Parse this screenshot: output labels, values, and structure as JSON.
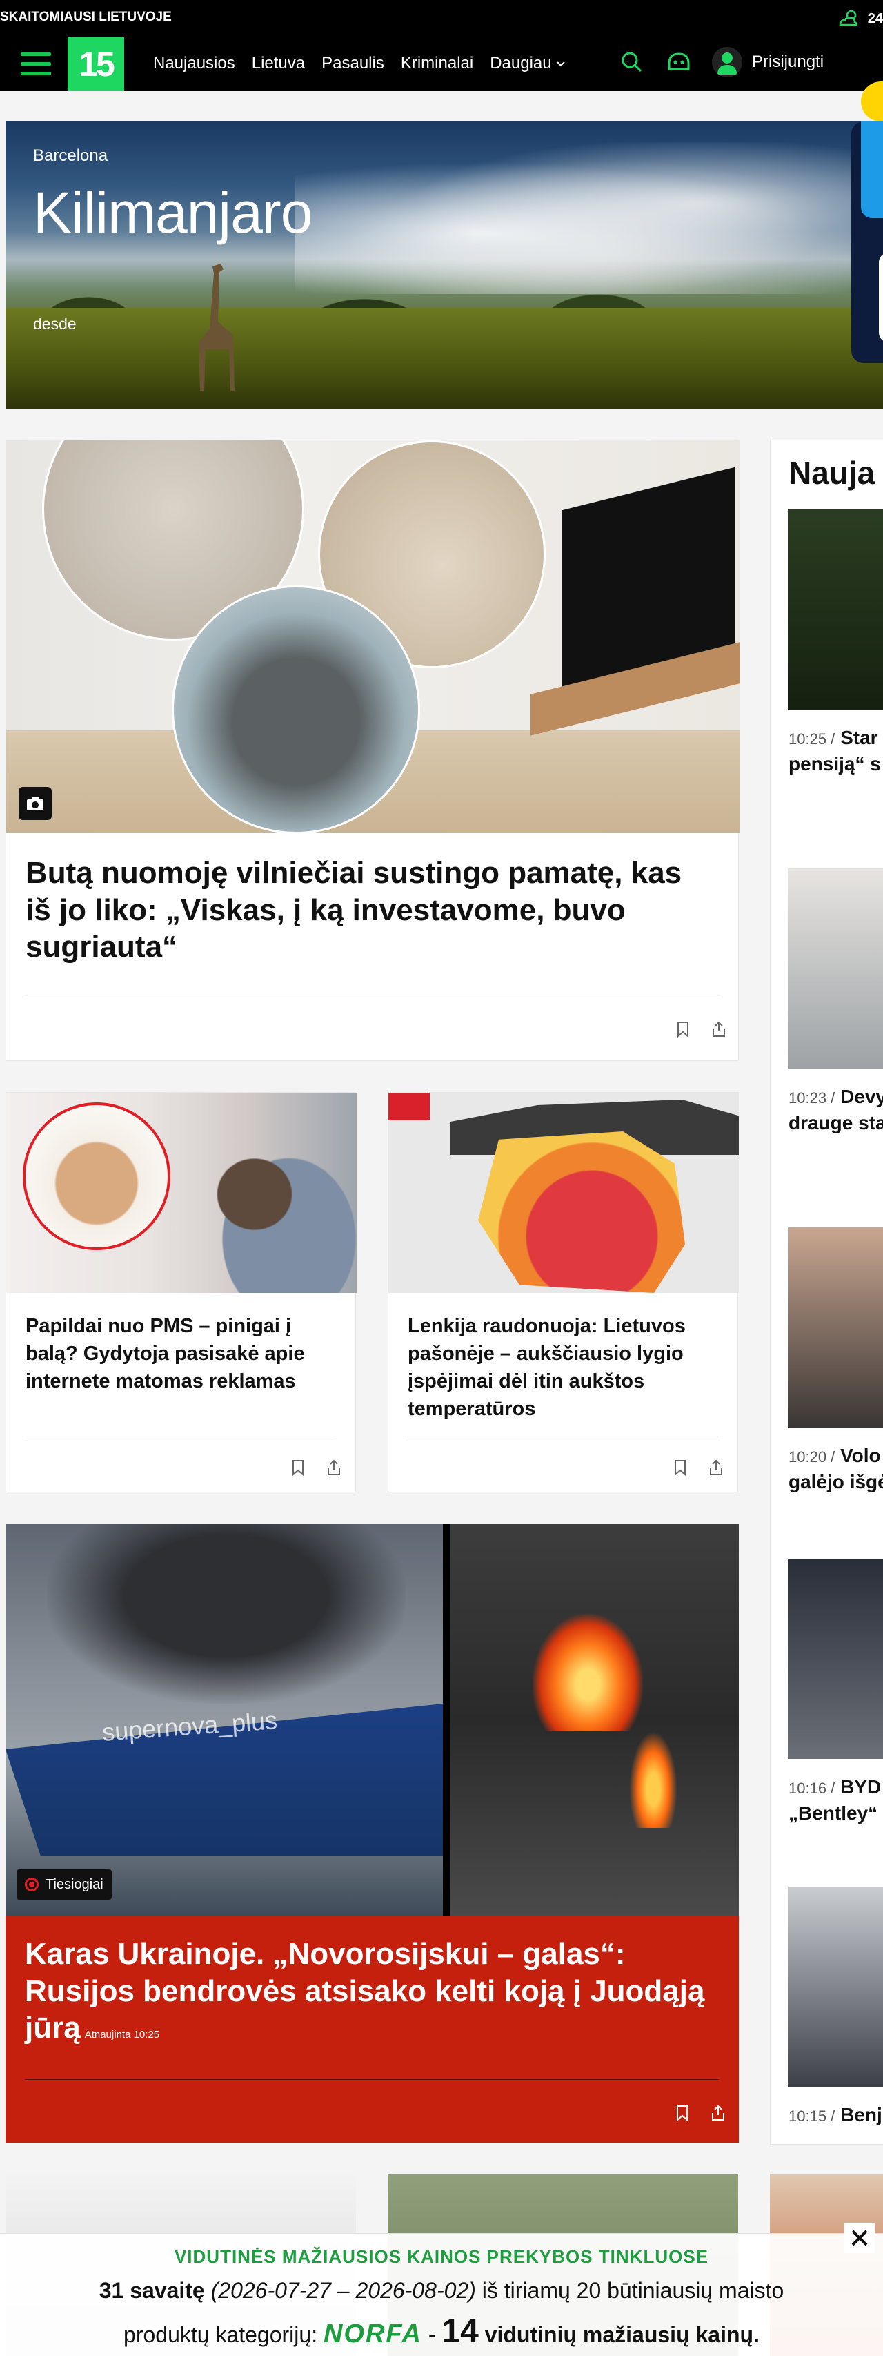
{
  "topbar": {
    "tagline": "SKAITOMIAUSI LIETUVOJE",
    "temperature": "24",
    "weather_icon": "cloud-sun-icon"
  },
  "nav": {
    "logo": "15",
    "links": [
      "Naujausios",
      "Lietuva",
      "Pasaulis",
      "Kriminalai",
      "Daugiau"
    ],
    "login": "Prisijungti",
    "icons": [
      "menu-icon",
      "search-icon",
      "chat-icon",
      "user-icon"
    ]
  },
  "banner": {
    "city": "Barcelona",
    "title": "Kilimanjaro",
    "desde": "desde"
  },
  "main_article": {
    "headline": "Butą nuomoję vilniečiai sustingo pamatę, kas iš jo liko: „Viskas, į ką investavome, buvo sugriauta“"
  },
  "articles": [
    {
      "headline": "Papildai nuo PMS – pinigai į balą? Gydytoja pasisakė apie internete matomas reklamas"
    },
    {
      "headline": "Lenkija raudonuoja: Lietuvos pašonėje – aukščiausio lygio įspėjimai dėl itin aukštos temperatūros"
    }
  ],
  "live_article": {
    "badge": "Tiesiogiai",
    "headline": "Karas Ukrainoje. „Novorosijskui – galas“: Rusijos bendrovės atsisako kelti koją į Juodąją jūrą",
    "updated": "Atnaujinta 10:25",
    "photo_text": "supernova_plus"
  },
  "sidebar": {
    "title": "Nauja",
    "items": [
      {
        "time": "10:25 /",
        "text": "Star žinomi vei pensiją“ s taip juos is"
      },
      {
        "time": "10:23 /",
        "text": "Devy Estijos me drauge sta ligoninėse"
      },
      {
        "time": "10:20 /",
        "text": "Volo balistinių galėjo išgė"
      },
      {
        "time": "10:16 /",
        "text": "BYD visureigį, „Bentley“"
      },
      {
        "time": "10:15 /",
        "text": "Benj"
      }
    ]
  },
  "promo": {
    "head": "VIDUTINĖS MAŽIAUSIOS KAINOS PREKYBOS TINKLUOSE",
    "week": "31 savaitę",
    "dates": "(2026-07-27 – 2026-08-02)",
    "line1_rest": "iš tiriamų 20 būtiniausių maisto",
    "line2_a": "produktų kategorijų:",
    "brand": "NORFA",
    "dash": "-",
    "count": "14",
    "line2_b": "vidutinių mažiausių kainų."
  }
}
